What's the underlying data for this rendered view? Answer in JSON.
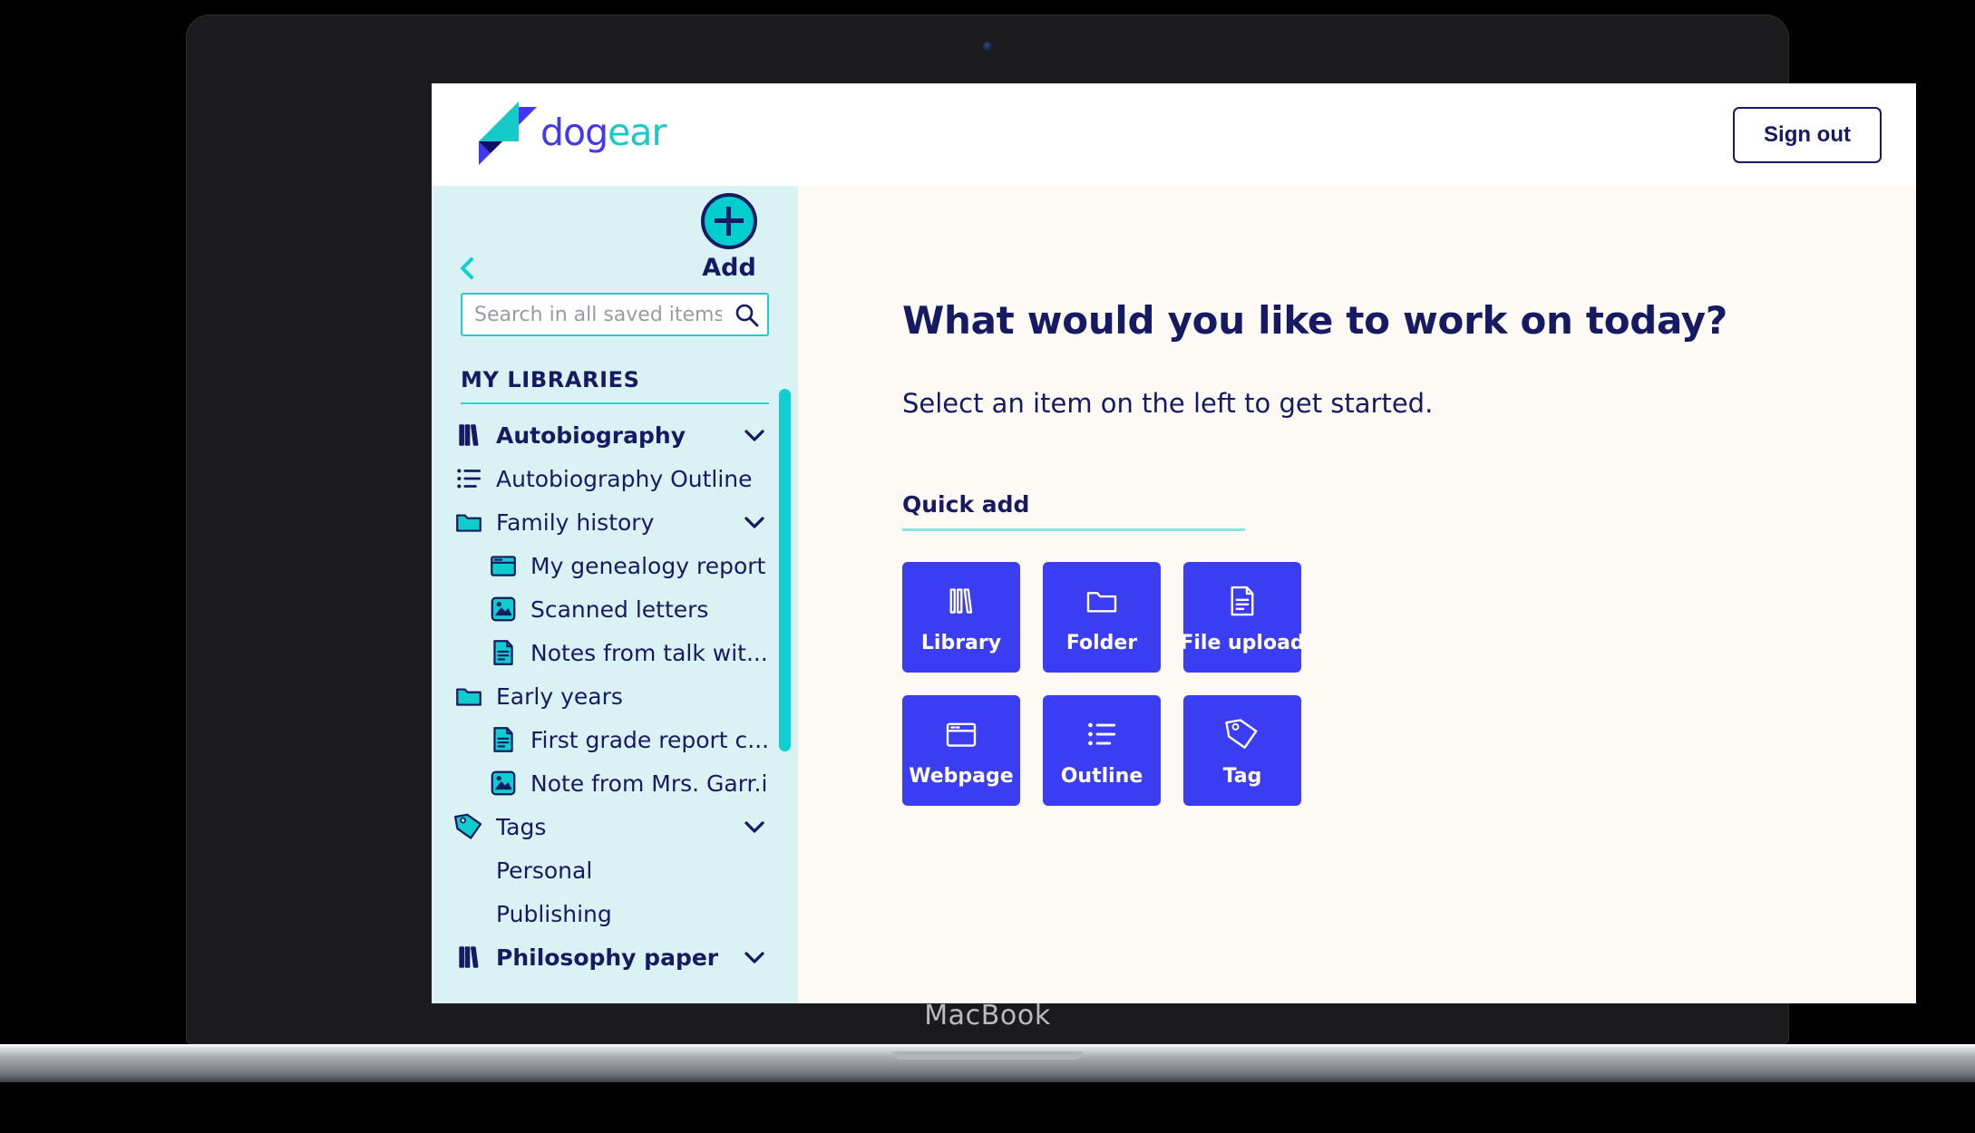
{
  "device": {
    "label": "MacBook"
  },
  "colors": {
    "brand_blue": "#3b3df2",
    "brand_teal": "#00cdcd",
    "navy": "#161a62",
    "sidebar_bg": "#daf2f3",
    "main_bg": "#fdfaf5",
    "tile_blue": "#3b3df2",
    "accent_underline": "#8ce3dc"
  },
  "header": {
    "logo_text_primary": "dog",
    "logo_text_accent": "ear",
    "sign_out_label": "Sign out"
  },
  "sidebar": {
    "collapse_icon": "chevron-left-icon",
    "add_label": "Add",
    "add_icon": "plus-circle-icon",
    "search": {
      "placeholder": "Search in all saved items...",
      "value": "",
      "icon": "search-icon"
    },
    "libraries_heading": "MY LIBRARIES",
    "tree": [
      {
        "label": "Autobiography",
        "icon": "library-icon",
        "level": 0,
        "bold": true,
        "chevron": "chevron-down-icon"
      },
      {
        "label": "Autobiography Outline",
        "icon": "outline-icon",
        "level": 0,
        "bold": false,
        "chevron": ""
      },
      {
        "label": "Family history",
        "icon": "folder-icon",
        "level": 0,
        "bold": false,
        "chevron": "chevron-down-icon"
      },
      {
        "label": "My genealogy report",
        "icon": "webpage-icon",
        "level": 1,
        "bold": false,
        "chevron": ""
      },
      {
        "label": "Scanned letters",
        "icon": "image-icon",
        "level": 1,
        "bold": false,
        "chevron": ""
      },
      {
        "label": "Notes from talk wit...",
        "icon": "document-icon",
        "level": 1,
        "bold": false,
        "chevron": ""
      },
      {
        "label": "Early years",
        "icon": "folder-icon",
        "level": 0,
        "bold": false,
        "chevron": ""
      },
      {
        "label": "First grade report c...",
        "icon": "document-icon",
        "level": 1,
        "bold": false,
        "chevron": ""
      },
      {
        "label": "Note from Mrs. Garr.i...",
        "icon": "image-icon",
        "level": 1,
        "bold": false,
        "chevron": ""
      },
      {
        "label": "Tags",
        "icon": "tag-icon",
        "level": 0,
        "bold": false,
        "chevron": "chevron-down-icon"
      },
      {
        "label": "Personal",
        "icon": "",
        "level": 0,
        "bold": false,
        "chevron": ""
      },
      {
        "label": "Publishing",
        "icon": "",
        "level": 0,
        "bold": false,
        "chevron": ""
      },
      {
        "label": "Philosophy paper",
        "icon": "library-icon",
        "level": 0,
        "bold": true,
        "chevron": "chevron-down-icon"
      }
    ],
    "scrollbar": "vertical-scrollbar"
  },
  "main": {
    "title": "What would you like to work on today?",
    "subtitle": "Select an item on the left to get started.",
    "quick_add_label": "Quick add",
    "tiles": [
      {
        "label": "Library",
        "icon": "library-icon"
      },
      {
        "label": "Folder",
        "icon": "folder-icon"
      },
      {
        "label": "File upload",
        "icon": "document-icon"
      },
      {
        "label": "Webpage",
        "icon": "webpage-icon"
      },
      {
        "label": "Outline",
        "icon": "outline-icon"
      },
      {
        "label": "Tag",
        "icon": "tag-icon"
      }
    ]
  }
}
